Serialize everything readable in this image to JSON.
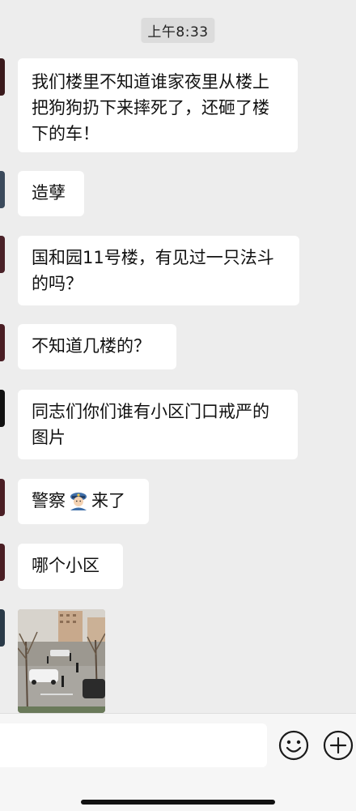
{
  "timestamp": "上午8:33",
  "messages": [
    {
      "text": "我们楼里不知道谁家夜里从楼上把狗狗扔下来摔死了，还砸了楼下的车！"
    },
    {
      "text": "造孽"
    },
    {
      "text": "国和园11号楼，有见过一只法斗的吗？"
    },
    {
      "text": "不知道几楼的？"
    },
    {
      "text": "同志们你们谁有小区门口戒严的图片"
    },
    {
      "text_before": "警察",
      "emoji": "police-officer-emoji",
      "text_after": "来了"
    },
    {
      "text": "哪个小区"
    }
  ],
  "composer": {
    "placeholder": "",
    "emoji_icon": "smiley-icon",
    "plus_icon": "plus-circle-icon"
  },
  "colors": {
    "background": "#ededed",
    "bubble": "#ffffff",
    "timestamp_bg": "#dcdcdc",
    "bottom_bar": "#f6f6f6"
  }
}
